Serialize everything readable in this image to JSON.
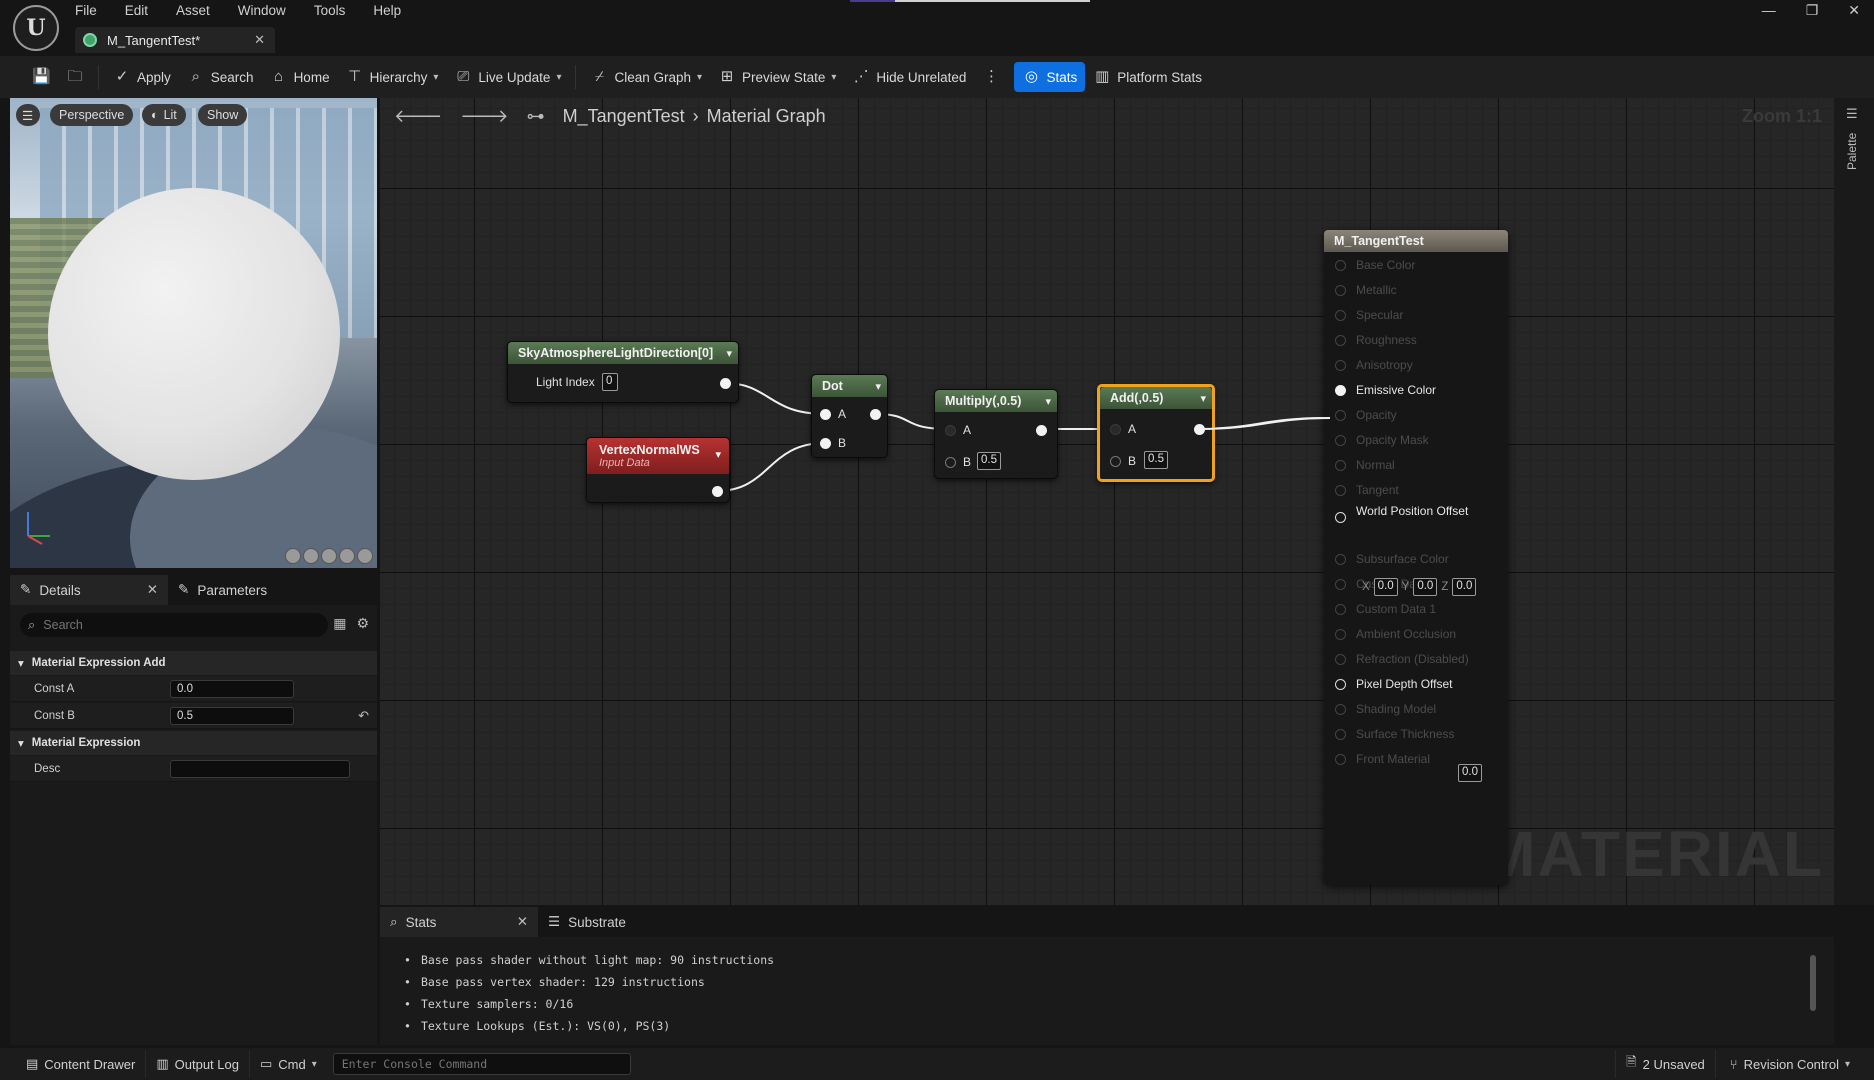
{
  "app": {
    "menu": [
      "File",
      "Edit",
      "Asset",
      "Window",
      "Tools",
      "Help"
    ],
    "tab_title": "M_TangentTest*",
    "logo_text": "U"
  },
  "toolbar": {
    "apply": "Apply",
    "search": "Search",
    "home": "Home",
    "hierarchy": "Hierarchy",
    "live_update": "Live Update",
    "clean_graph": "Clean Graph",
    "preview_state": "Preview State",
    "hide_unrelated": "Hide Unrelated",
    "stats": "Stats",
    "platform_stats": "Platform Stats"
  },
  "viewport": {
    "perspective": "Perspective",
    "lit": "Lit",
    "show": "Show"
  },
  "details": {
    "tab_details": "Details",
    "tab_parameters": "Parameters",
    "search_placeholder": "Search",
    "category1": "Material Expression Add",
    "const_a_label": "Const A",
    "const_a_value": "0.0",
    "const_b_label": "Const B",
    "const_b_value": "0.5",
    "category2": "Material Expression",
    "desc_label": "Desc",
    "desc_value": ""
  },
  "graph": {
    "breadcrumb_asset": "M_TangentTest",
    "breadcrumb_graph": "Material Graph",
    "zoom": "Zoom 1:1",
    "watermark": "MATERIAL",
    "palette": "Palette",
    "nodes": {
      "sky": {
        "title": "SkyAtmosphereLightDirection[0]",
        "pin_label": "Light Index",
        "pin_value": "0"
      },
      "vertex": {
        "title": "VertexNormalWS",
        "subtitle": "Input Data"
      },
      "dot": {
        "title": "Dot",
        "a": "A",
        "b": "B"
      },
      "multiply": {
        "title": "Multiply(,0.5)",
        "a": "A",
        "b": "B",
        "b_value": "0.5"
      },
      "add": {
        "title": "Add(,0.5)",
        "a": "A",
        "b": "B",
        "b_value": "0.5"
      }
    },
    "result": {
      "title": "M_TangentTest",
      "pins": [
        {
          "label": "Base Color",
          "active": false
        },
        {
          "label": "Metallic",
          "active": false
        },
        {
          "label": "Specular",
          "active": false
        },
        {
          "label": "Roughness",
          "active": false
        },
        {
          "label": "Anisotropy",
          "active": false
        },
        {
          "label": "Emissive Color",
          "active": true
        },
        {
          "label": "Opacity",
          "active": false
        },
        {
          "label": "Opacity Mask",
          "active": false
        },
        {
          "label": "Normal",
          "active": false
        },
        {
          "label": "Tangent",
          "active": false
        },
        {
          "label": "World Position Offset",
          "active": true
        },
        {
          "label": "Subsurface Color",
          "active": false
        },
        {
          "label": "Custom Data 0",
          "active": false
        },
        {
          "label": "Custom Data 1",
          "active": false
        },
        {
          "label": "Ambient Occlusion",
          "active": false
        },
        {
          "label": "Refraction (Disabled)",
          "active": false
        },
        {
          "label": "Pixel Depth Offset",
          "active": true
        },
        {
          "label": "Shading Model",
          "active": false
        },
        {
          "label": "Surface Thickness",
          "active": false
        },
        {
          "label": "Front Material",
          "active": false
        }
      ],
      "wpo": {
        "x_label": "X",
        "x": "0.0",
        "y_label": "Y",
        "y": "0.0",
        "z_label": "Z",
        "z": "0.0"
      },
      "pdo_value": "0.0"
    }
  },
  "stats": {
    "tab_stats": "Stats",
    "tab_substrate": "Substrate",
    "lines": [
      "Base pass shader without light map: 90 instructions",
      "Base pass vertex shader: 129 instructions",
      "Texture samplers: 0/16",
      "Texture Lookups (Est.): VS(0), PS(3)"
    ]
  },
  "statusbar": {
    "content_drawer": "Content Drawer",
    "output_log": "Output Log",
    "cmd": "Cmd",
    "console_placeholder": "Enter Console Command",
    "unsaved": "2 Unsaved",
    "revision_control": "Revision Control"
  }
}
